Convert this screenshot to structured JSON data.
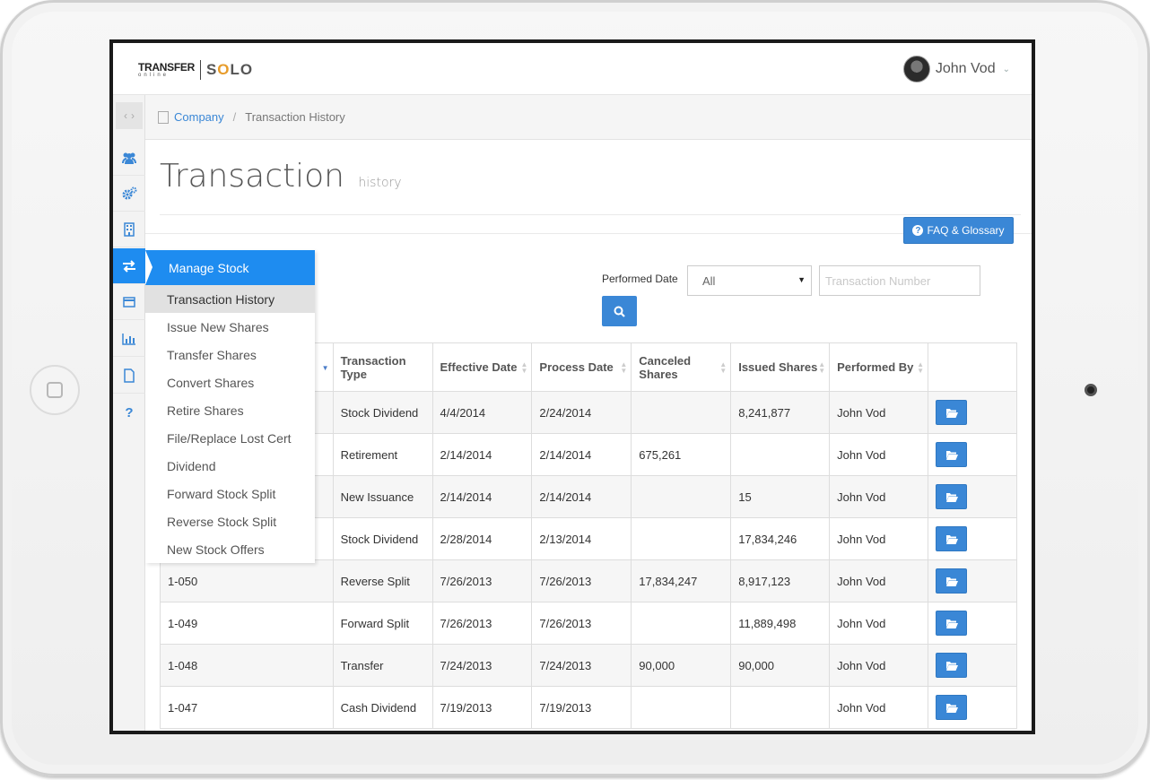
{
  "app": {
    "logo_transfer": "TRANSFER",
    "logo_online": "online",
    "logo_solo": "SOLO"
  },
  "user": {
    "name": "John Vod"
  },
  "breadcrumb": {
    "company": "Company",
    "current": "Transaction History"
  },
  "page": {
    "title": "Transaction",
    "subtitle": "history"
  },
  "faq_button": {
    "label": "FAQ & Glossary"
  },
  "filters": {
    "performed_date_label": "Performed Date",
    "performed_date_value": "All",
    "transaction_number_placeholder": "Transaction Number"
  },
  "menu": {
    "heading": "Manage Stock",
    "items": [
      "Transaction History",
      "Issue New Shares",
      "Transfer Shares",
      "Convert Shares",
      "Retire Shares",
      "File/Replace Lost Cert",
      "Dividend",
      "Forward Stock Split",
      "Reverse Stock Split",
      "New Stock Offers"
    ]
  },
  "table": {
    "headers": [
      "",
      "Transaction Type",
      "Effective Date",
      "Process Date",
      "Canceled Shares",
      "Issued Shares",
      "Performed By",
      ""
    ],
    "rows": [
      [
        "",
        "Stock Dividend",
        "4/4/2014",
        "2/24/2014",
        "",
        "8,241,877",
        "John Vod"
      ],
      [
        "",
        "Retirement",
        "2/14/2014",
        "2/14/2014",
        "675,261",
        "",
        "John Vod"
      ],
      [
        "",
        "New Issuance",
        "2/14/2014",
        "2/14/2014",
        "",
        "15",
        "John Vod"
      ],
      [
        "",
        "Stock Dividend",
        "2/28/2014",
        "2/13/2014",
        "",
        "17,834,246",
        "John Vod"
      ],
      [
        "1-050",
        "Reverse Split",
        "7/26/2013",
        "7/26/2013",
        "17,834,247",
        "8,917,123",
        "John Vod"
      ],
      [
        "1-049",
        "Forward Split",
        "7/26/2013",
        "7/26/2013",
        "",
        "11,889,498",
        "John Vod"
      ],
      [
        "1-048",
        "Transfer",
        "7/24/2013",
        "7/24/2013",
        "90,000",
        "90,000",
        "John Vod"
      ],
      [
        "1-047",
        "Cash Dividend",
        "7/19/2013",
        "7/19/2013",
        "",
        "",
        "John Vod"
      ]
    ]
  },
  "sidebar_icons": [
    "users-icon",
    "gears-icon",
    "building-icon",
    "exchange-icon",
    "card-icon",
    "bar-chart-icon",
    "document-icon",
    "question-icon"
  ],
  "colors": {
    "accent": "#3a87d6",
    "active_menu": "#1e8cf0",
    "logo_orange": "#e79c2b"
  }
}
